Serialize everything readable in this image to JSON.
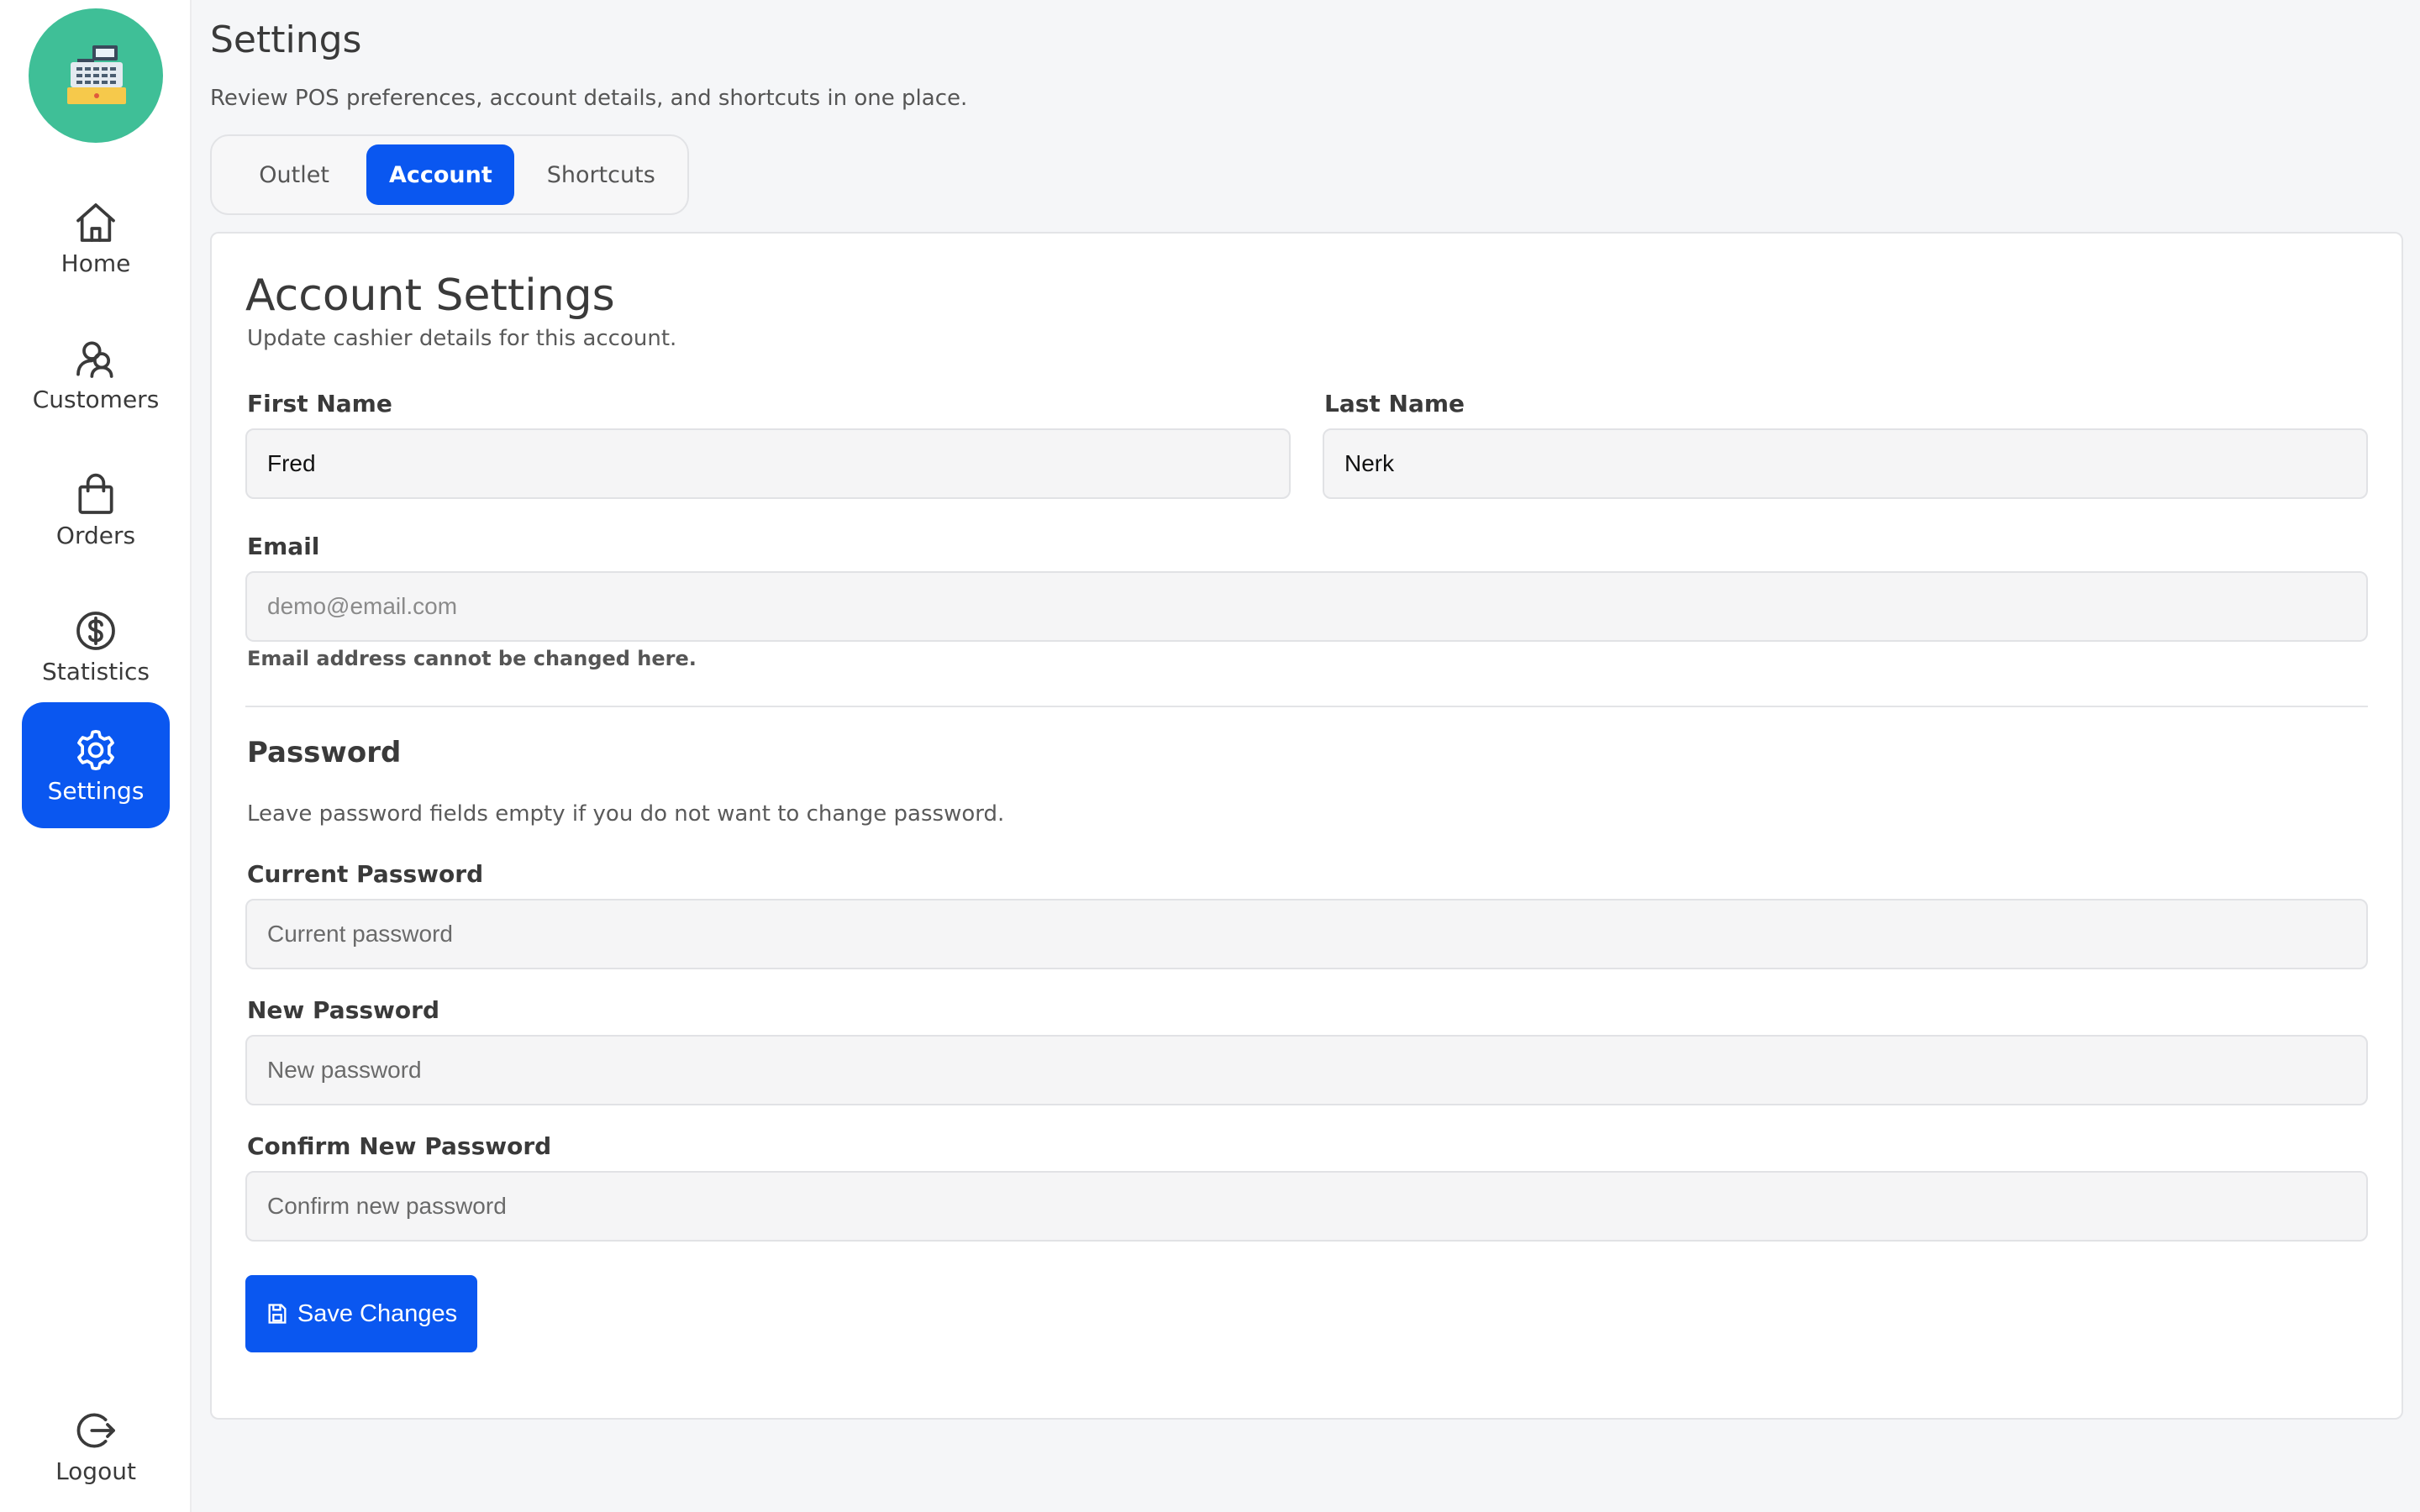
{
  "sidebar": {
    "items": [
      {
        "label": "Home",
        "icon": "home-icon"
      },
      {
        "label": "Customers",
        "icon": "customers-icon"
      },
      {
        "label": "Orders",
        "icon": "shopping-bag-icon"
      },
      {
        "label": "Statistics",
        "icon": "dollar-circle-icon"
      },
      {
        "label": "Settings",
        "icon": "gear-icon",
        "active": true
      }
    ],
    "logout_label": "Logout"
  },
  "header": {
    "title": "Settings",
    "subtitle": "Review POS preferences, account details, and shortcuts in one place."
  },
  "tabs": [
    {
      "label": "Outlet"
    },
    {
      "label": "Account",
      "active": true
    },
    {
      "label": "Shortcuts"
    }
  ],
  "account": {
    "title": "Account Settings",
    "subtitle": "Update cashier details for this account.",
    "first_name": {
      "label": "First Name",
      "value": "Fred"
    },
    "last_name": {
      "label": "Last Name",
      "value": "Nerk"
    },
    "email": {
      "label": "Email",
      "value": "demo@email.com",
      "help": "Email address cannot be changed here."
    },
    "password_section": {
      "title": "Password",
      "description": "Leave password fields empty if you do not want to change password."
    },
    "current_password": {
      "label": "Current Password",
      "placeholder": "Current password"
    },
    "new_password": {
      "label": "New Password",
      "placeholder": "New password"
    },
    "confirm_password": {
      "label": "Confirm New Password",
      "placeholder": "Confirm new password"
    },
    "save_label": "Save Changes"
  },
  "colors": {
    "accent": "#0a57f0",
    "logo_background": "#3fbf97",
    "page_background": "#f5f6f8"
  }
}
